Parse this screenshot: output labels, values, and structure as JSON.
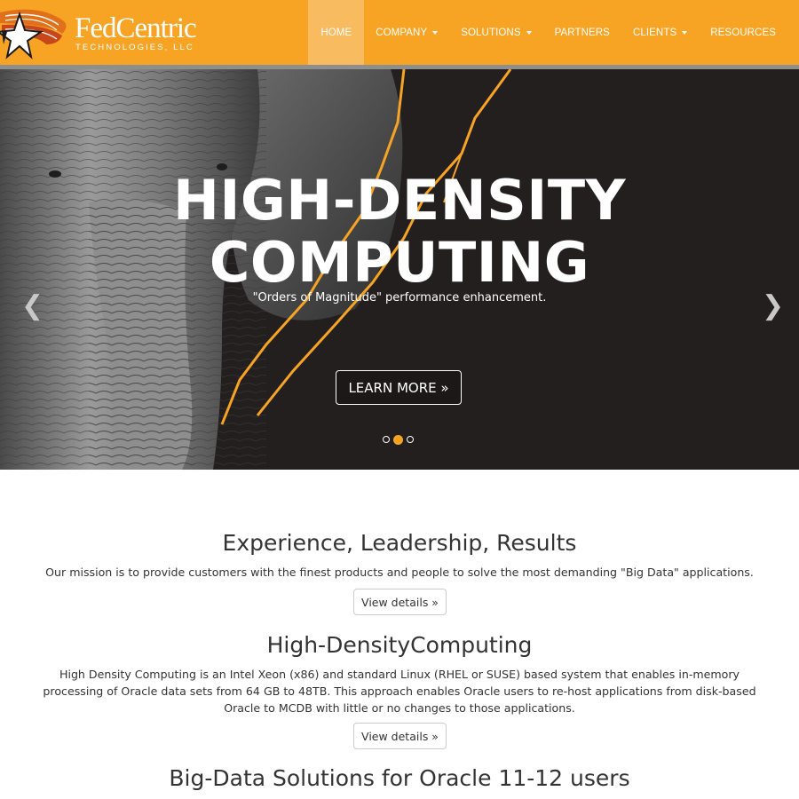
{
  "header": {
    "logo_name": "FedCentric",
    "logo_sub": "TECHNOLOGIES, LLC",
    "nav": [
      {
        "label": "HOME",
        "dropdown": false,
        "active": true
      },
      {
        "label": "COMPANY",
        "dropdown": true
      },
      {
        "label": "SOLUTIONS",
        "dropdown": true
      },
      {
        "label": "PARTNERS",
        "dropdown": false
      },
      {
        "label": "CLIENTS",
        "dropdown": true
      },
      {
        "label": "RESOURCES",
        "dropdown": false
      }
    ]
  },
  "hero": {
    "title_line1": "HIGH-DENSITY",
    "title_line2": "COMPUTING",
    "subtitle": "\"Orders of Magnitude\" performance enhancement.",
    "button_label": "LEARN MORE »",
    "prev_icon": "chevron-left-icon",
    "next_icon": "chevron-right-icon",
    "slide_count": 3,
    "active_slide": 2
  },
  "sections": [
    {
      "title": "Experience, Leadership, Results",
      "text": "Our mission is to provide customers with the finest products and people to solve the most demanding \"Big Data\" applications.",
      "button_label": "View details »"
    },
    {
      "title": "High-DensityComputing",
      "text": "High Density Computing is an Intel Xeon (x86) and standard Linux (RHEL or SUSE) based system that enables in-memory processing of Oracle data sets from 64 GB to 48TB. This approach enables Oracle users to re-host applications from disk-based Oracle to MCDB with little or no changes to those applications.",
      "button_label": "View details »"
    },
    {
      "title": "Big-Data Solutions for Oracle 11-12 users"
    }
  ],
  "colors": {
    "brand_orange": "#f7a425",
    "nav_active": "#f9bb5f",
    "hero_bg": "#231f1f"
  }
}
